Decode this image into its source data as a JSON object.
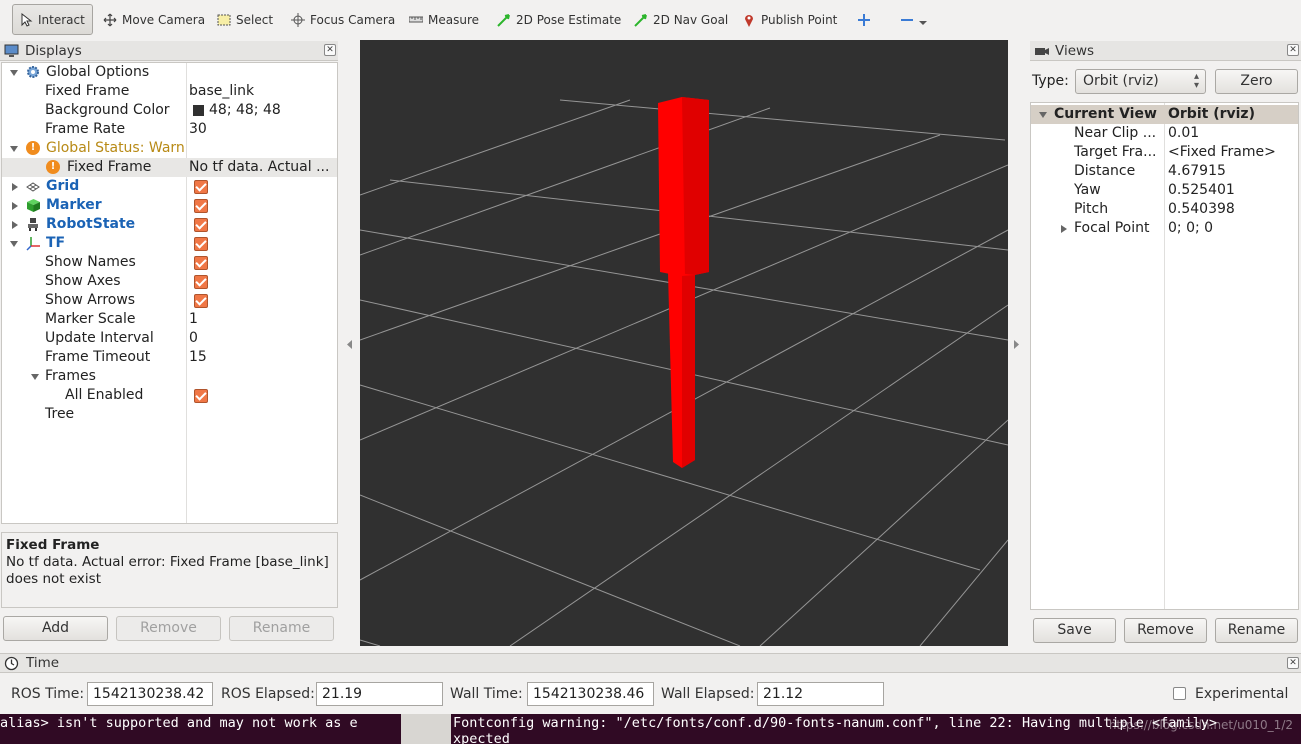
{
  "toolbar": {
    "interact": "Interact",
    "move_camera": "Move Camera",
    "select": "Select",
    "focus_camera": "Focus Camera",
    "measure": "Measure",
    "pose_estimate": "2D Pose Estimate",
    "nav_goal": "2D Nav Goal",
    "publish_point": "Publish Point"
  },
  "displays": {
    "title": "Displays",
    "rows": {
      "global_options": "Global Options",
      "fixed_frame": {
        "name": "Fixed Frame",
        "value": "base_link"
      },
      "background_color": {
        "name": "Background Color",
        "value": "48; 48; 48"
      },
      "frame_rate": {
        "name": "Frame Rate",
        "value": "30"
      },
      "global_status": "Global Status: Warn",
      "status_fixed_frame": {
        "name": "Fixed Frame",
        "value": "No tf data.  Actual ..."
      },
      "grid": "Grid",
      "marker": "Marker",
      "robotstate": "RobotState",
      "tf": "TF",
      "show_names": "Show Names",
      "show_axes": "Show Axes",
      "show_arrows": "Show Arrows",
      "marker_scale": {
        "name": "Marker Scale",
        "value": "1"
      },
      "update_interval": {
        "name": "Update Interval",
        "value": "0"
      },
      "frame_timeout": {
        "name": "Frame Timeout",
        "value": "15"
      },
      "frames": "Frames",
      "all_enabled": "All Enabled",
      "tree": "Tree"
    },
    "desc_title": "Fixed Frame",
    "desc_text": "No tf data. Actual error: Fixed Frame [base_link] does not exist",
    "buttons": {
      "add": "Add",
      "remove": "Remove",
      "rename": "Rename"
    }
  },
  "views": {
    "title": "Views",
    "type_label": "Type:",
    "type_value": "Orbit (rviz)",
    "zero": "Zero",
    "header": {
      "name": "Current View",
      "value": "Orbit (rviz)"
    },
    "rows": [
      {
        "name": "Near Clip ...",
        "value": "0.01"
      },
      {
        "name": "Target Fra...",
        "value": "<Fixed Frame>"
      },
      {
        "name": "Distance",
        "value": "4.67915"
      },
      {
        "name": "Yaw",
        "value": "0.525401"
      },
      {
        "name": "Pitch",
        "value": "0.540398"
      },
      {
        "name": "Focal Point",
        "value": "0; 0; 0"
      }
    ],
    "buttons": {
      "save": "Save",
      "remove": "Remove",
      "rename": "Rename"
    }
  },
  "time": {
    "title": "Time",
    "ros_time_label": "ROS Time:",
    "ros_time": "1542130238.42",
    "ros_elapsed_label": "ROS Elapsed:",
    "ros_elapsed": "21.19",
    "wall_time_label": "Wall Time:",
    "wall_time": "1542130238.46",
    "wall_elapsed_label": "Wall Elapsed:",
    "wall_elapsed": "21.12",
    "experimental": "Experimental"
  },
  "terminal": {
    "left_line": "alias> isn't supported and may not work as e",
    "right_line1": "Fontconfig warning: \"/etc/fonts/conf.d/90-fonts-nanum.conf\", line 22: Having multiple <family>",
    "right_line2": "xpected",
    "watermark": "https://blog.csdn.net/u010_1/2"
  },
  "colors": {
    "viewport_bg": "#303030",
    "marker": "#ff0000",
    "checkbox": "#f07746",
    "link_blue": "#1b63b5",
    "warn_text": "#b88a16",
    "terminal_bg": "#300a24"
  }
}
